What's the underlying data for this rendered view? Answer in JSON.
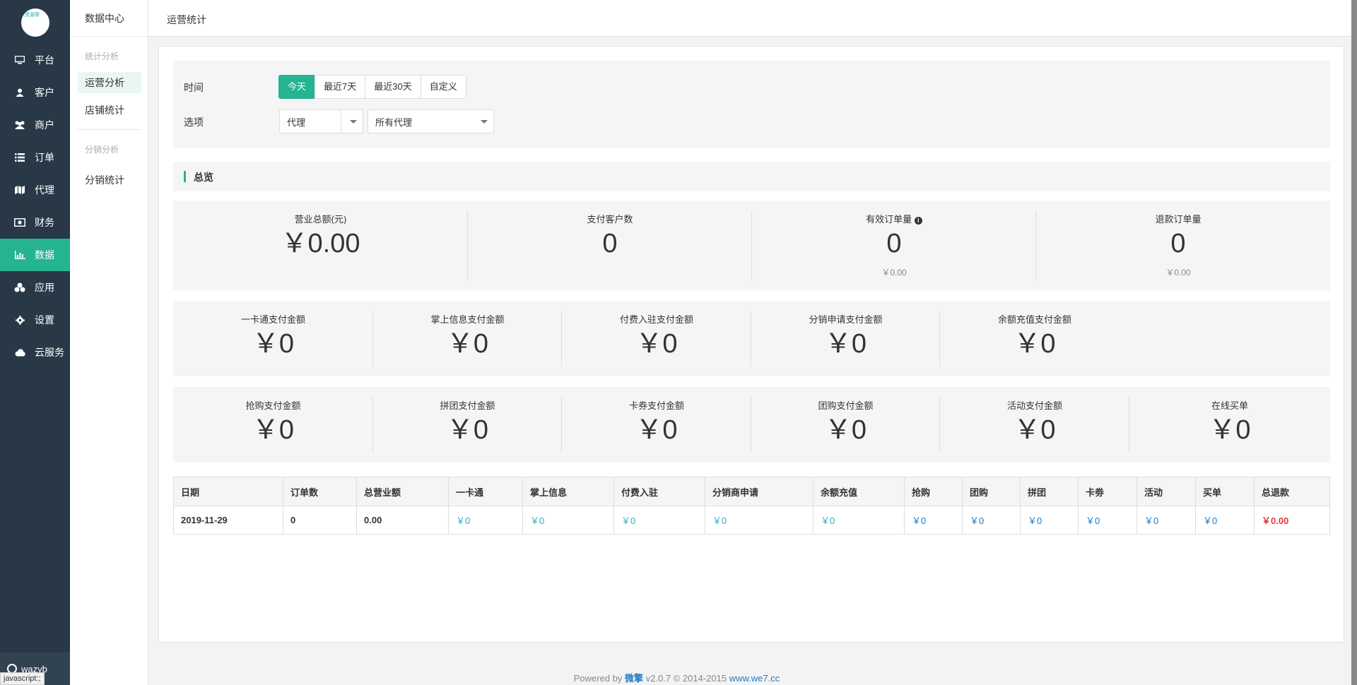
{
  "sidebar": {
    "logo_text": "资源帮",
    "items": [
      {
        "label": "平台",
        "icon": "monitor-icon"
      },
      {
        "label": "客户",
        "icon": "user-icon"
      },
      {
        "label": "商户",
        "icon": "users-icon"
      },
      {
        "label": "订单",
        "icon": "list-icon"
      },
      {
        "label": "代理",
        "icon": "map-icon"
      },
      {
        "label": "财务",
        "icon": "money-icon"
      },
      {
        "label": "数据",
        "icon": "bar-chart-icon",
        "active": true
      },
      {
        "label": "应用",
        "icon": "cubes-icon"
      },
      {
        "label": "设置",
        "icon": "gear-icon"
      },
      {
        "label": "云服务",
        "icon": "cloud-icon"
      }
    ],
    "user": "wazyb",
    "status_text": "javascript:;"
  },
  "subnav": {
    "title": "数据中心",
    "group1": "统计分析",
    "item_operation": "运营分析",
    "item_store": "店铺统计",
    "group2": "分销分析",
    "item_distribution": "分销统计"
  },
  "topbar": {
    "breadcrumb": "运营统计"
  },
  "filter": {
    "time_label": "时间",
    "time_options": [
      "今天",
      "最近7天",
      "最近30天",
      "自定义"
    ],
    "option_label": "选项",
    "select_type": "代理",
    "select_agent": "所有代理"
  },
  "overview": {
    "title": "总览",
    "stats": [
      {
        "label": "营业总额(元)",
        "value": "￥0.00"
      },
      {
        "label": "支付客户数",
        "value": "0"
      },
      {
        "label": "有效订单量",
        "value": "0",
        "sub": "￥0.00"
      },
      {
        "label": "退款订单量",
        "value": "0",
        "sub": "￥0.00"
      }
    ]
  },
  "payments_row1": [
    {
      "label": "一卡通支付金额",
      "value": "￥0"
    },
    {
      "label": "掌上信息支付金额",
      "value": "￥0"
    },
    {
      "label": "付费入驻支付金额",
      "value": "￥0"
    },
    {
      "label": "分销申请支付金额",
      "value": "￥0"
    },
    {
      "label": "余额充值支付金额",
      "value": "￥0"
    }
  ],
  "payments_row2": [
    {
      "label": "抢购支付金额",
      "value": "￥0"
    },
    {
      "label": "拼团支付金额",
      "value": "￥0"
    },
    {
      "label": "卡券支付金额",
      "value": "￥0"
    },
    {
      "label": "团购支付金额",
      "value": "￥0"
    },
    {
      "label": "活动支付金额",
      "value": "￥0"
    },
    {
      "label": "在线买单",
      "value": "￥0"
    }
  ],
  "table": {
    "headers": [
      "日期",
      "订单数",
      "总营业额",
      "一卡通",
      "掌上信息",
      "付费入驻",
      "分销商申请",
      "余额充值",
      "抢购",
      "团购",
      "拼团",
      "卡劵",
      "活动",
      "买单",
      "总退款"
    ],
    "row": [
      "2019-11-29",
      "0",
      "0.00",
      "￥0",
      "￥0",
      "￥0",
      "￥0",
      "￥0",
      "￥0",
      "￥0",
      "￥0",
      "￥0",
      "￥0",
      "￥0",
      "￥0.00"
    ]
  },
  "footer": {
    "powered": "Powered by",
    "brand": "微擎",
    "version": "v2.0.7 © 2014-2015",
    "link": "www.we7.cc"
  },
  "colors": {
    "sidebar": "#283847",
    "accent": "#25b392",
    "link": "#1e7bc8",
    "red": "#e4393c"
  }
}
